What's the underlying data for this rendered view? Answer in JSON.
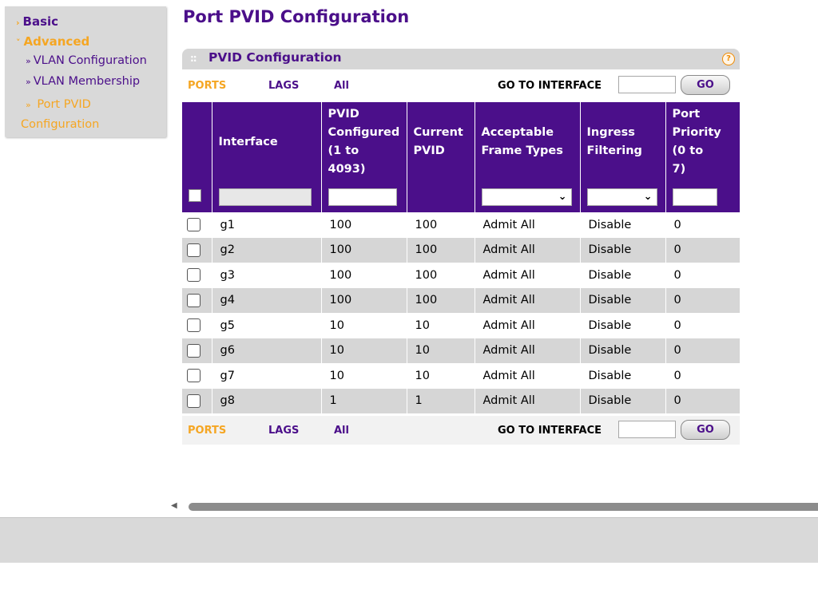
{
  "sidebar": {
    "basic": "Basic",
    "advanced": "Advanced",
    "items": [
      {
        "label": "VLAN Configuration"
      },
      {
        "label": "VLAN Membership"
      },
      {
        "label": "Port PVID Configuration"
      }
    ],
    "pvid_line1": "Port PVID",
    "pvid_line2": "Configuration"
  },
  "page": {
    "title": "Port PVID Configuration"
  },
  "panel": {
    "title": "PVID Configuration",
    "help": "?"
  },
  "filter_bar": {
    "ports": "PORTS",
    "lags": "LAGS",
    "all": "All",
    "goto": "GO TO INTERFACE",
    "go": "GO"
  },
  "table": {
    "headers": {
      "interface": "Interface",
      "pvid_l1": "PVID",
      "pvid_l2": "Configured",
      "pvid_l3": "(1 to",
      "pvid_l4": "4093)",
      "current_l1": "Current",
      "current_l2": "PVID",
      "frame_l1": "Acceptable",
      "frame_l2": "Frame Types",
      "ingress_l1": "Ingress",
      "ingress_l2": "Filtering",
      "prio_l1": "Port",
      "prio_l2": "Priority",
      "prio_l3": "(0 to",
      "prio_l4": "7)"
    },
    "rows": [
      {
        "interface": "g1",
        "pvid": "100",
        "current": "100",
        "frame": "Admit All",
        "ingress": "Disable",
        "priority": "0"
      },
      {
        "interface": "g2",
        "pvid": "100",
        "current": "100",
        "frame": "Admit All",
        "ingress": "Disable",
        "priority": "0"
      },
      {
        "interface": "g3",
        "pvid": "100",
        "current": "100",
        "frame": "Admit All",
        "ingress": "Disable",
        "priority": "0"
      },
      {
        "interface": "g4",
        "pvid": "100",
        "current": "100",
        "frame": "Admit All",
        "ingress": "Disable",
        "priority": "0"
      },
      {
        "interface": "g5",
        "pvid": "10",
        "current": "10",
        "frame": "Admit All",
        "ingress": "Disable",
        "priority": "0"
      },
      {
        "interface": "g6",
        "pvid": "10",
        "current": "10",
        "frame": "Admit All",
        "ingress": "Disable",
        "priority": "0"
      },
      {
        "interface": "g7",
        "pvid": "10",
        "current": "10",
        "frame": "Admit All",
        "ingress": "Disable",
        "priority": "0"
      },
      {
        "interface": "g8",
        "pvid": "1",
        "current": "1",
        "frame": "Admit All",
        "ingress": "Disable",
        "priority": "0"
      }
    ]
  },
  "colors": {
    "brand_purple": "#4b0f8a",
    "accent_orange": "#f5a623",
    "row_alt": "#d6d6d6"
  },
  "icons": {
    "help": "help-icon",
    "chevron": "chevron-down-icon",
    "scroll_left": "arrow-left-icon"
  }
}
